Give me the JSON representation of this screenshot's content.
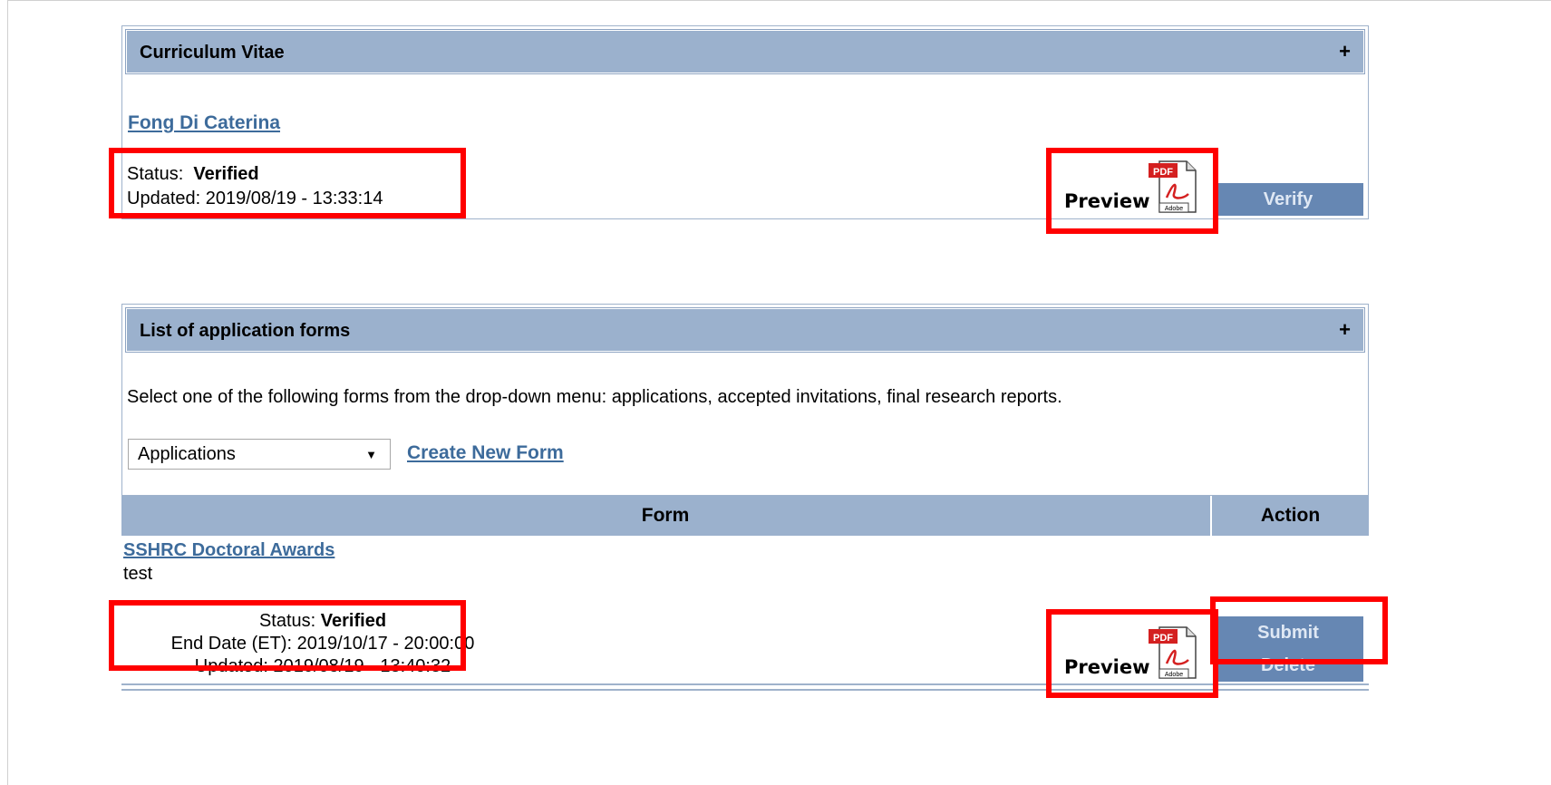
{
  "cv_panel": {
    "title": "Curriculum Vitae",
    "expand_symbol": "+",
    "name_link": "Fong Di Caterina",
    "status_label": "Status:",
    "status_value": "Verified",
    "updated_label": "Updated:",
    "updated_value": "2019/08/19 - 13:33:14",
    "preview_label": "Preview",
    "pdf_badge": "PDF",
    "adobe_label": "Adobe",
    "verify_button": "Verify"
  },
  "forms_panel": {
    "title": "List of application forms",
    "expand_symbol": "+",
    "instructions": "Select one of the following forms from the drop-down menu: applications, accepted invitations, final research reports.",
    "select_value": "Applications",
    "create_link": "Create New Form",
    "table": {
      "headers": [
        "Form",
        "Action"
      ],
      "row": {
        "form_link": "SSHRC Doctoral Awards",
        "form_subtitle": "test",
        "status_label": "Status:",
        "status_value": "Verified",
        "end_date_label": "End Date (ET):",
        "end_date_value": "2019/10/17 - 20:00:00",
        "updated_label": "Updated:",
        "updated_value": "2019/08/19 - 13:40:32",
        "preview_label": "Preview",
        "pdf_badge": "PDF",
        "adobe_label": "Adobe",
        "submit_button": "Submit",
        "delete_button": "Delete"
      }
    }
  },
  "colors": {
    "header_blue": "#9bb1cd",
    "button_blue": "#6687b3",
    "link_blue": "#3d6b9b",
    "highlight_red": "#ff0000"
  }
}
